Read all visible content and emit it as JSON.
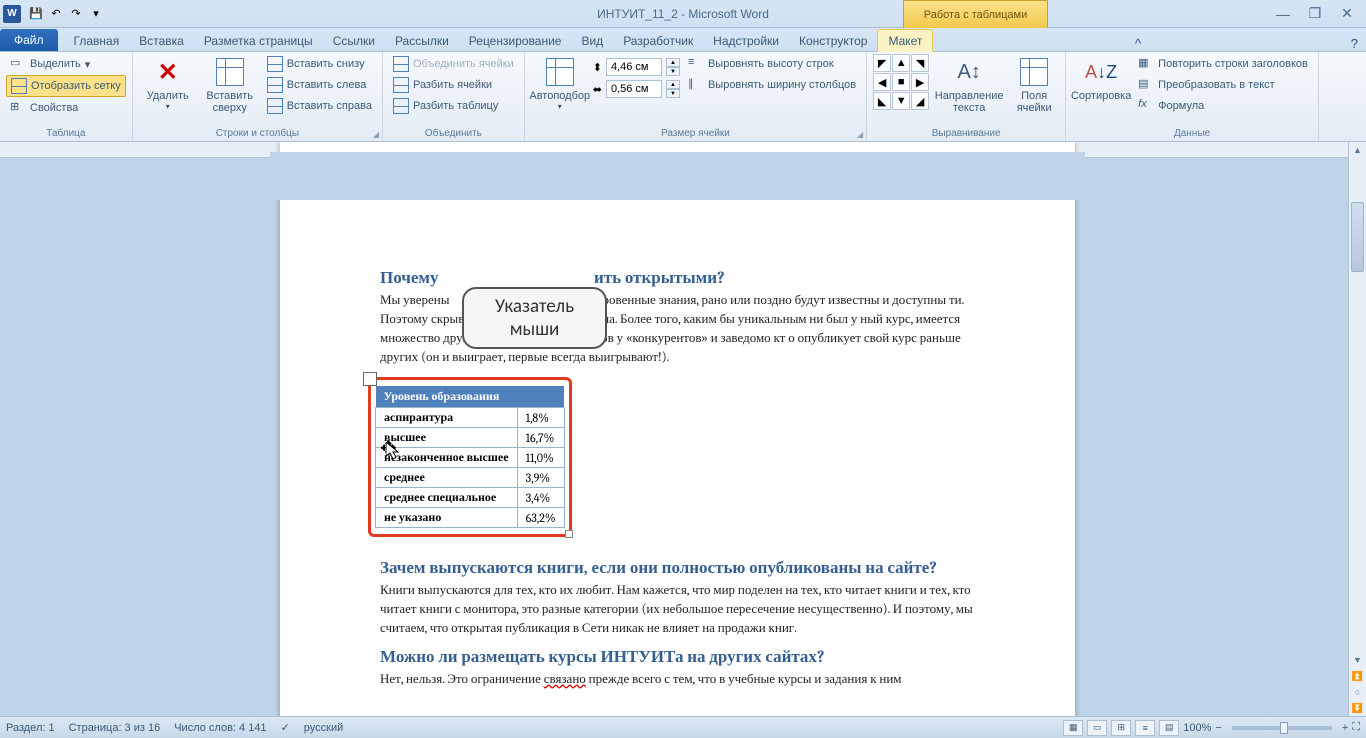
{
  "title": "ИНТУИТ_11_2 - Microsoft Word",
  "contextTabGroup": "Работа с таблицами",
  "fileTab": "Файл",
  "tabs": [
    "Главная",
    "Вставка",
    "Разметка страницы",
    "Ссылки",
    "Рассылки",
    "Рецензирование",
    "Вид",
    "Разработчик",
    "Надстройки"
  ],
  "contextTabs": [
    "Конструктор",
    "Макет"
  ],
  "ribbon": {
    "table": {
      "label": "Таблица",
      "select": "Выделить",
      "gridlines": "Отобразить сетку",
      "properties": "Свойства"
    },
    "rowscols": {
      "label": "Строки и столбцы",
      "delete": "Удалить",
      "insertAbove": "Вставить сверху",
      "insertBelow": "Вставить снизу",
      "insertLeft": "Вставить слева",
      "insertRight": "Вставить справа"
    },
    "merge": {
      "label": "Объединить",
      "mergeCells": "Объединить ячейки",
      "splitCells": "Разбить ячейки",
      "splitTable": "Разбить таблицу"
    },
    "size": {
      "label": "Размер ячейки",
      "autofit": "Автоподбор",
      "height": "4,46 см",
      "width": "0,56 см",
      "distRows": "Выровнять высоту строк",
      "distCols": "Выровнять ширину столбцов"
    },
    "align": {
      "label": "Выравнивание",
      "textDir": "Направление текста",
      "cellMargins": "Поля ячейки"
    },
    "data": {
      "label": "Данные",
      "sort": "Сортировка",
      "repeatHeader": "Повторить строки заголовков",
      "convertText": "Преобразовать в текст",
      "formula": "Формула"
    }
  },
  "doc": {
    "h1": "Почему ",
    "h1_end": "ить открытыми?",
    "p1a": "Мы уверены",
    "p1b": "юбые, даже самые сокровенные знания, рано или поздно будут известны и доступны",
    "p1c": "ти. Поэтому скрывать их нет никакого смысла. Более того, каким бы уникальным ни был у",
    "p1d": "ный курс, имеется множество других альтернативных курсов у «конкурентов» и заведомо кт",
    "p1e": "о опубликует свой курс раньше других (он и выиграет, первые всегда выигрывают!).",
    "tableHeader": "Уровень образования",
    "rows": [
      {
        "k": "аспирантура",
        "v": "1,8%"
      },
      {
        "k": "высшее",
        "v": "16,7%"
      },
      {
        "k": "незаконченное высшее",
        "v": "11,0%"
      },
      {
        "k": "среднее",
        "v": "3,9%"
      },
      {
        "k": "среднее специальное",
        "v": "3,4%"
      },
      {
        "k": "не указано",
        "v": "63,2%"
      }
    ],
    "h2": "Зачем выпускаются книги, если они полностью опубликованы на сайте?",
    "p2": "Книги выпускаются для тех, кто их любит. Нам кажется, что мир поделен на тех, кто читает книги и тех, кто читает книги с монитора, это разные категории (их небольшое пересечение несущественно). И поэтому, мы считаем, что открытая публикация в Сети никак не влияет на продажи книг.",
    "h3": "Можно ли размещать курсы ИНТУИТа на других сайтах?",
    "p3a": "Нет, нельзя. Это ограничение ",
    "p3b": "связано",
    "p3c": " прежде всего с тем, что в учебные курсы и задания к ним"
  },
  "callout": {
    "l1": "Указатель",
    "l2": "мыши"
  },
  "status": {
    "section": "Раздел: 1",
    "page": "Страница: 3 из 16",
    "words": "Число слов: 4 141",
    "lang": "русский",
    "zoom": "100%"
  }
}
